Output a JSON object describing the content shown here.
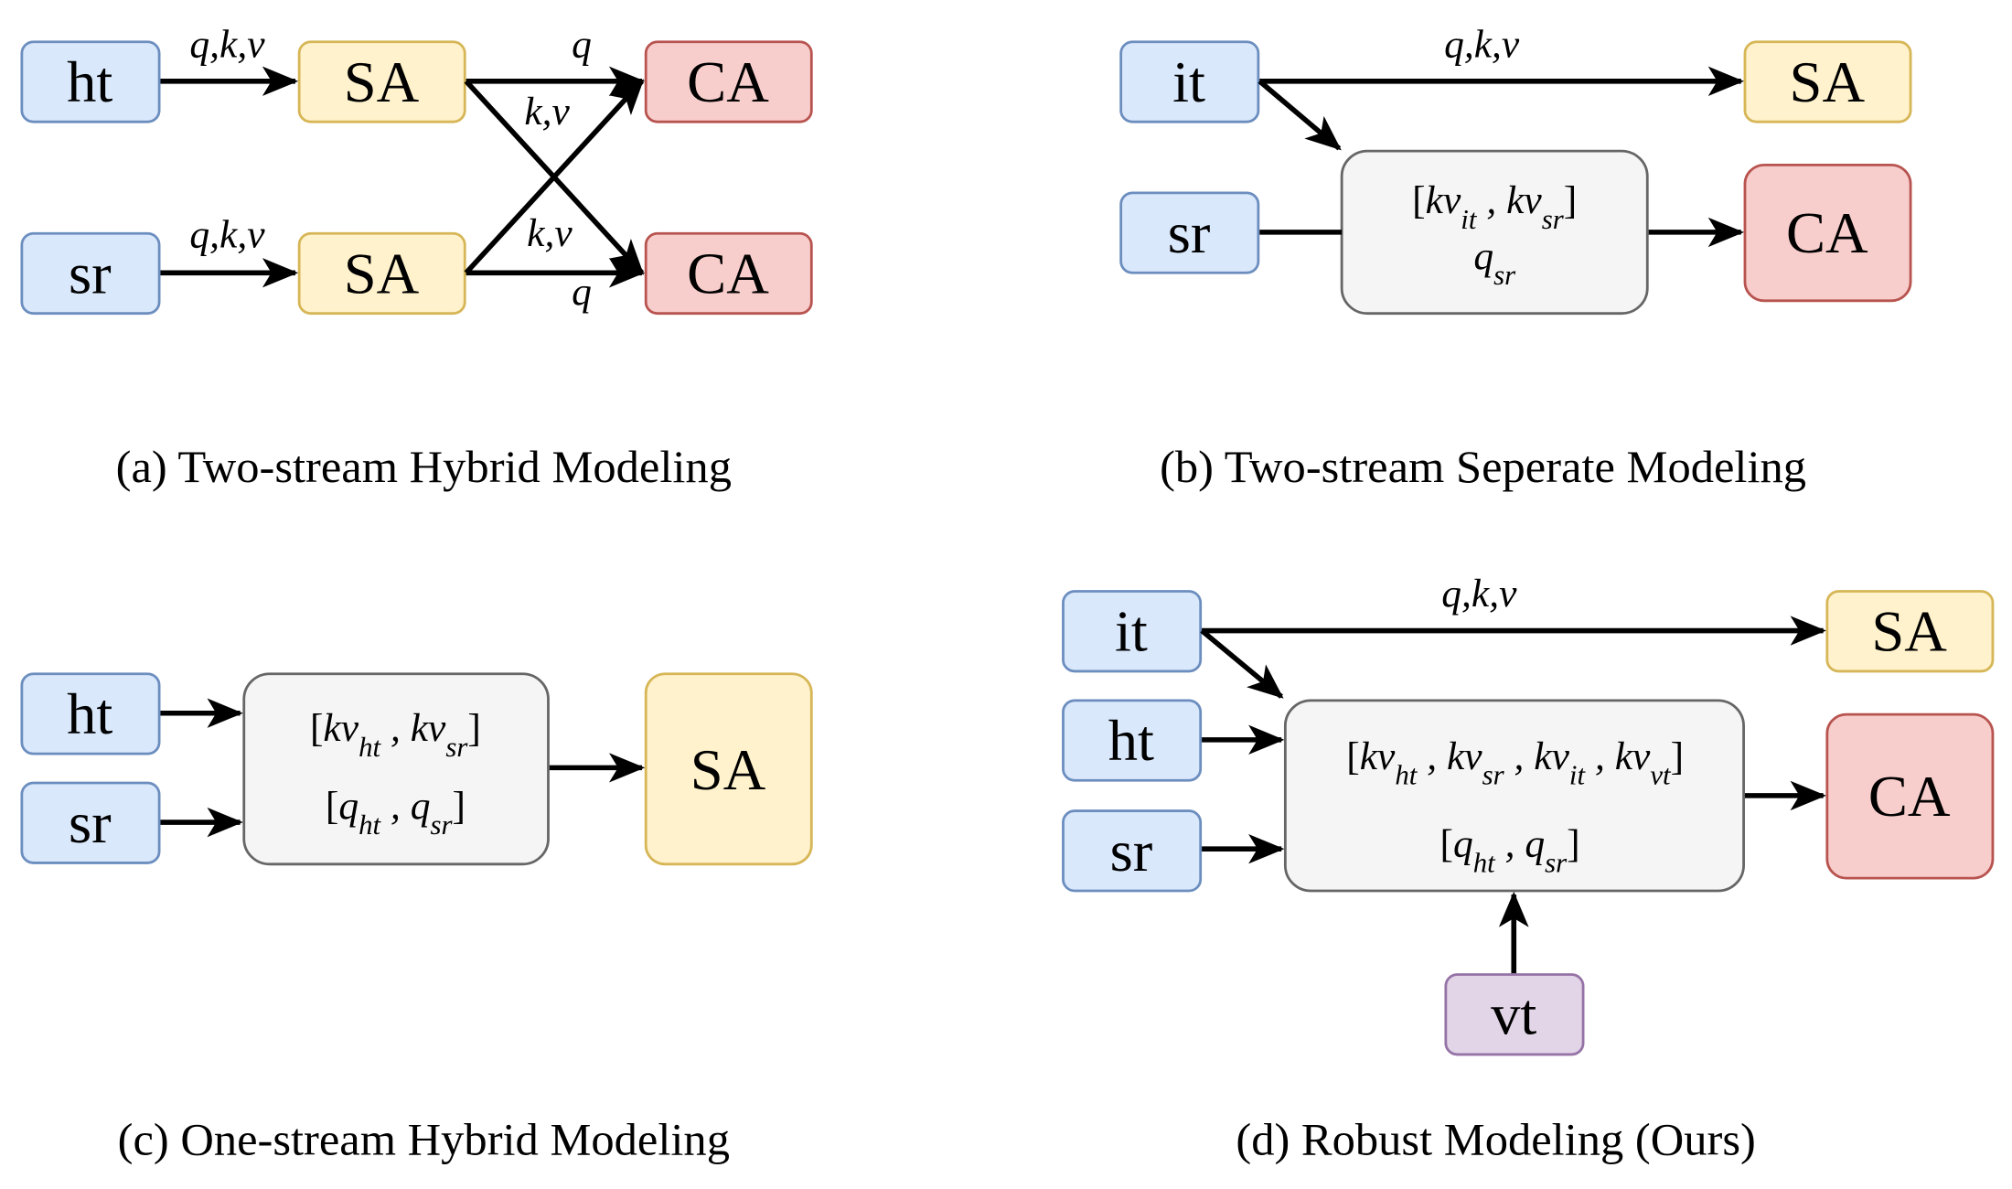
{
  "colors": {
    "input_fill": "#dae8fc",
    "input_stroke": "#6c8ebf",
    "sa_fill": "#fff2cc",
    "sa_stroke": "#d6b656",
    "ca_fill": "#f8cecc",
    "ca_stroke": "#b85450",
    "mix_fill": "#f5f5f5",
    "mix_stroke": "#666666",
    "vt_fill": "#e1d5e7",
    "vt_stroke": "#9673a6"
  },
  "panels": {
    "a": {
      "caption": "(a) Two-stream Hybrid Modeling",
      "ht": "ht",
      "sr": "sr",
      "sa1": "SA",
      "sa2": "SA",
      "ca1": "CA",
      "ca2": "CA",
      "qkv1": "q,k,v",
      "qkv2": "q,k,v",
      "q1": "q",
      "kv1": "k,v",
      "kv2": "k,v",
      "q2": "q"
    },
    "b": {
      "caption": "(b) Two-stream Seperate Modeling",
      "it": "it",
      "sr": "sr",
      "sa": "SA",
      "ca": "CA",
      "qkv": "q,k,v",
      "mix_line1": "[kv",
      "mix_sub1": "it",
      "mix_sep1": " , kv",
      "mix_sub2": "sr",
      "mix_end1": "]",
      "mix_q": "q",
      "mix_qsub": "sr"
    },
    "c": {
      "caption": "(c) One-stream Hybrid Modeling",
      "ht": "ht",
      "sr": "sr",
      "sa": "SA",
      "kv_open": "[kv",
      "kv_sub1": "ht",
      "kv_sep": " , kv",
      "kv_sub2": "sr",
      "kv_close": "]",
      "q_open": "[q",
      "q_sub1": "ht",
      "q_sep": " , q",
      "q_sub2": "sr",
      "q_close": "]"
    },
    "d": {
      "caption": "(d) Robust Modeling (Ours)",
      "it": "it",
      "ht": "ht",
      "sr": "sr",
      "vt": "vt",
      "sa": "SA",
      "ca": "CA",
      "qkv": "q,k,v",
      "kv_open": "[kv",
      "kv_sub1": "ht",
      "kv_sep1": " , kv",
      "kv_sub2": "sr",
      "kv_sep2": " , kv",
      "kv_sub3": "it",
      "kv_sep3": " , kv",
      "kv_sub4": "vt",
      "kv_close": "]",
      "q_open": "[q",
      "q_sub1": "ht",
      "q_sep": " , q",
      "q_sub2": "sr",
      "q_close": "]"
    }
  }
}
